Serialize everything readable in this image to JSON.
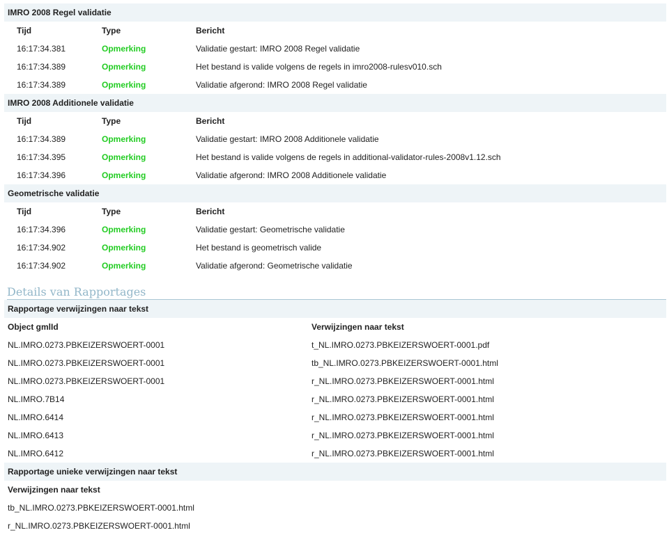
{
  "validation_sections": [
    {
      "title": "IMRO 2008 Regel validatie",
      "columns": {
        "tijd": "Tijd",
        "type": "Type",
        "bericht": "Bericht"
      },
      "rows": [
        {
          "tijd": "16:17:34.381",
          "type": "Opmerking",
          "bericht": "Validatie gestart: IMRO 2008 Regel validatie"
        },
        {
          "tijd": "16:17:34.389",
          "type": "Opmerking",
          "bericht": "Het bestand is valide volgens de regels in imro2008-rulesv010.sch"
        },
        {
          "tijd": "16:17:34.389",
          "type": "Opmerking",
          "bericht": "Validatie afgerond: IMRO 2008 Regel validatie"
        }
      ]
    },
    {
      "title": "IMRO 2008 Additionele validatie",
      "columns": {
        "tijd": "Tijd",
        "type": "Type",
        "bericht": "Bericht"
      },
      "rows": [
        {
          "tijd": "16:17:34.389",
          "type": "Opmerking",
          "bericht": "Validatie gestart: IMRO 2008 Additionele validatie"
        },
        {
          "tijd": "16:17:34.395",
          "type": "Opmerking",
          "bericht": "Het bestand is valide volgens de regels in additional-validator-rules-2008v1.12.sch"
        },
        {
          "tijd": "16:17:34.396",
          "type": "Opmerking",
          "bericht": "Validatie afgerond: IMRO 2008 Additionele validatie"
        }
      ]
    },
    {
      "title": "Geometrische validatie",
      "columns": {
        "tijd": "Tijd",
        "type": "Type",
        "bericht": "Bericht"
      },
      "rows": [
        {
          "tijd": "16:17:34.396",
          "type": "Opmerking",
          "bericht": "Validatie gestart: Geometrische validatie"
        },
        {
          "tijd": "16:17:34.902",
          "type": "Opmerking",
          "bericht": "Het bestand is geometrisch valide"
        },
        {
          "tijd": "16:17:34.902",
          "type": "Opmerking",
          "bericht": "Validatie afgerond: Geometrische validatie"
        }
      ]
    }
  ],
  "details": {
    "title": "Details van Rapportages",
    "references": {
      "title": "Rapportage verwijzingen naar tekst",
      "columns": {
        "object": "Object gmlId",
        "ref": "Verwijzingen naar tekst"
      },
      "rows": [
        {
          "object": "NL.IMRO.0273.PBKEIZERSWOERT-0001",
          "ref": "t_NL.IMRO.0273.PBKEIZERSWOERT-0001.pdf"
        },
        {
          "object": "NL.IMRO.0273.PBKEIZERSWOERT-0001",
          "ref": "tb_NL.IMRO.0273.PBKEIZERSWOERT-0001.html"
        },
        {
          "object": "NL.IMRO.0273.PBKEIZERSWOERT-0001",
          "ref": "r_NL.IMRO.0273.PBKEIZERSWOERT-0001.html"
        },
        {
          "object": "NL.IMRO.7B14",
          "ref": "r_NL.IMRO.0273.PBKEIZERSWOERT-0001.html"
        },
        {
          "object": "NL.IMRO.6414",
          "ref": "r_NL.IMRO.0273.PBKEIZERSWOERT-0001.html"
        },
        {
          "object": "NL.IMRO.6413",
          "ref": "r_NL.IMRO.0273.PBKEIZERSWOERT-0001.html"
        },
        {
          "object": "NL.IMRO.6412",
          "ref": "r_NL.IMRO.0273.PBKEIZERSWOERT-0001.html"
        }
      ]
    },
    "unique_references": {
      "title": "Rapportage unieke verwijzingen naar tekst",
      "column": "Verwijzingen naar tekst",
      "rows": [
        "tb_NL.IMRO.0273.PBKEIZERSWOERT-0001.html",
        "r_NL.IMRO.0273.PBKEIZERSWOERT-0001.html"
      ]
    }
  },
  "colors": {
    "section_bg": "#eef4f7",
    "opmerking": "#22cc22",
    "details_title": "#93b7c9"
  }
}
